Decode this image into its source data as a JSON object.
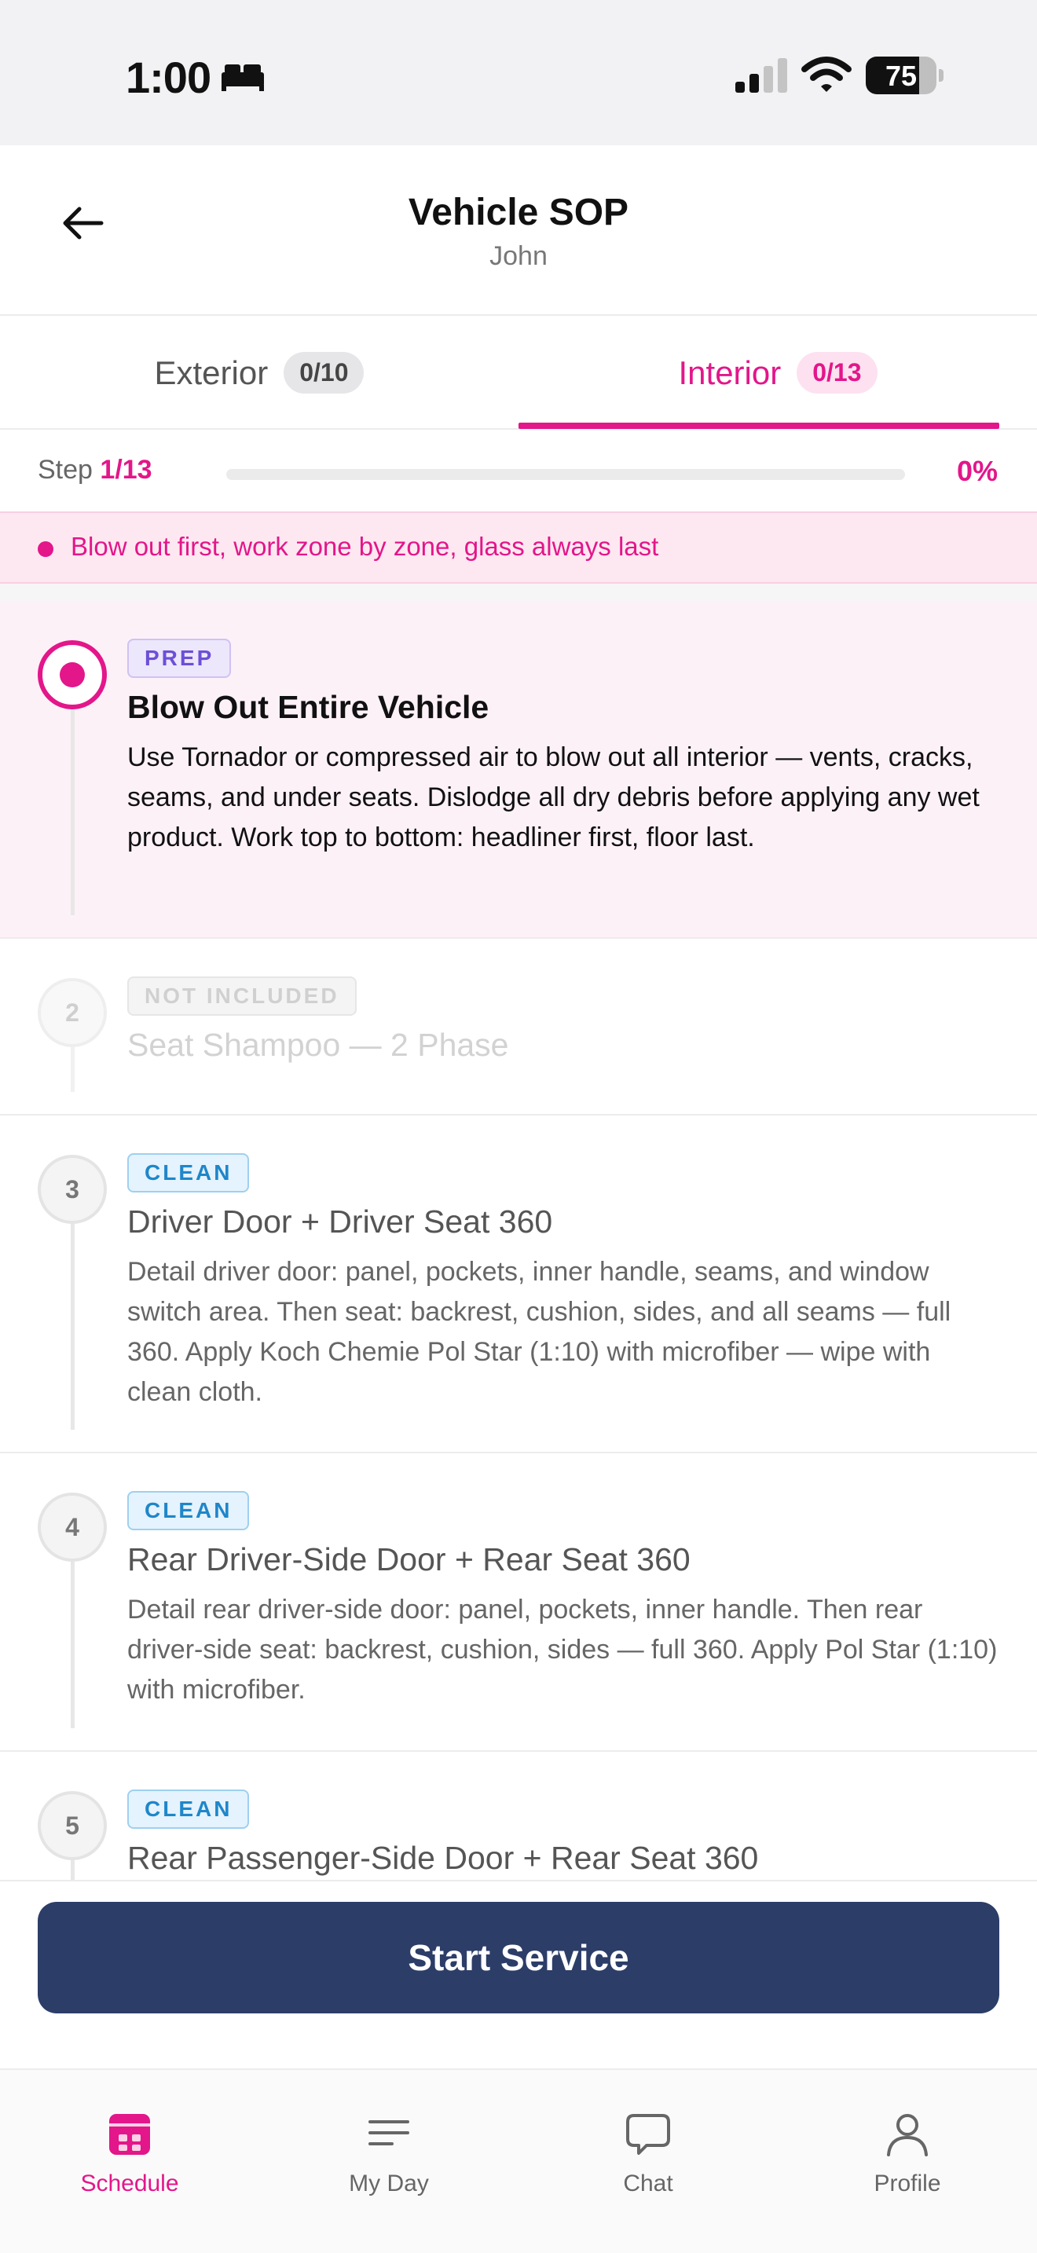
{
  "status_bar": {
    "time": "1:00",
    "battery": "75",
    "battery_level": 0.75
  },
  "header": {
    "title": "Vehicle SOP",
    "subtitle": "John"
  },
  "tabs": [
    {
      "label": "Exterior",
      "count": "0/10",
      "active": false
    },
    {
      "label": "Interior",
      "count": "0/13",
      "active": true
    }
  ],
  "progress": {
    "step_label": "Step",
    "step_value": "1/13",
    "percent": "0%",
    "fraction": 0
  },
  "tip": {
    "text": "Blow out first, work zone by zone, glass always last"
  },
  "steps": [
    {
      "number": "1",
      "tag": "PREP",
      "title": "Blow Out Entire Vehicle",
      "description": "Use Tornador or compressed air to blow out all interior — vents, cracks, seams, and under seats. Dislodge all dry debris before applying any wet product. Work top to bottom: headliner first, floor last.",
      "state": "active"
    },
    {
      "number": "2",
      "tag": "NOT INCLUDED",
      "title": "Seat Shampoo — 2 Phase",
      "description": "",
      "state": "not-included"
    },
    {
      "number": "3",
      "tag": "CLEAN",
      "title": "Driver Door + Driver Seat 360",
      "description": "Detail driver door: panel, pockets, inner handle, seams, and window switch area. Then seat: backrest, cushion, sides, and all seams — full 360. Apply Koch Chemie Pol Star (1:10) with microfiber — wipe with clean cloth.",
      "state": "pending"
    },
    {
      "number": "4",
      "tag": "CLEAN",
      "title": "Rear Driver-Side Door + Rear Seat 360",
      "description": "Detail rear driver-side door: panel, pockets, inner handle. Then rear driver-side seat: backrest, cushion, sides — full 360. Apply Pol Star (1:10) with microfiber.",
      "state": "pending"
    },
    {
      "number": "5",
      "tag": "CLEAN",
      "title": "Rear Passenger-Side Door + Rear Seat 360",
      "description": "",
      "state": "pending"
    }
  ],
  "footer": {
    "start_button": "Start Service"
  },
  "tabbar": [
    {
      "label": "Schedule",
      "icon": "calendar-icon",
      "active": true
    },
    {
      "label": "My Day",
      "icon": "list-icon",
      "active": false
    },
    {
      "label": "Chat",
      "icon": "chat-bubble-icon",
      "active": false
    },
    {
      "label": "Profile",
      "icon": "person-icon",
      "active": false
    }
  ],
  "colors": {
    "accent": "#e3168a",
    "primary_button": "#2c3d68",
    "prep_tag": "#6c4fd8",
    "clean_tag": "#1f86c9"
  }
}
